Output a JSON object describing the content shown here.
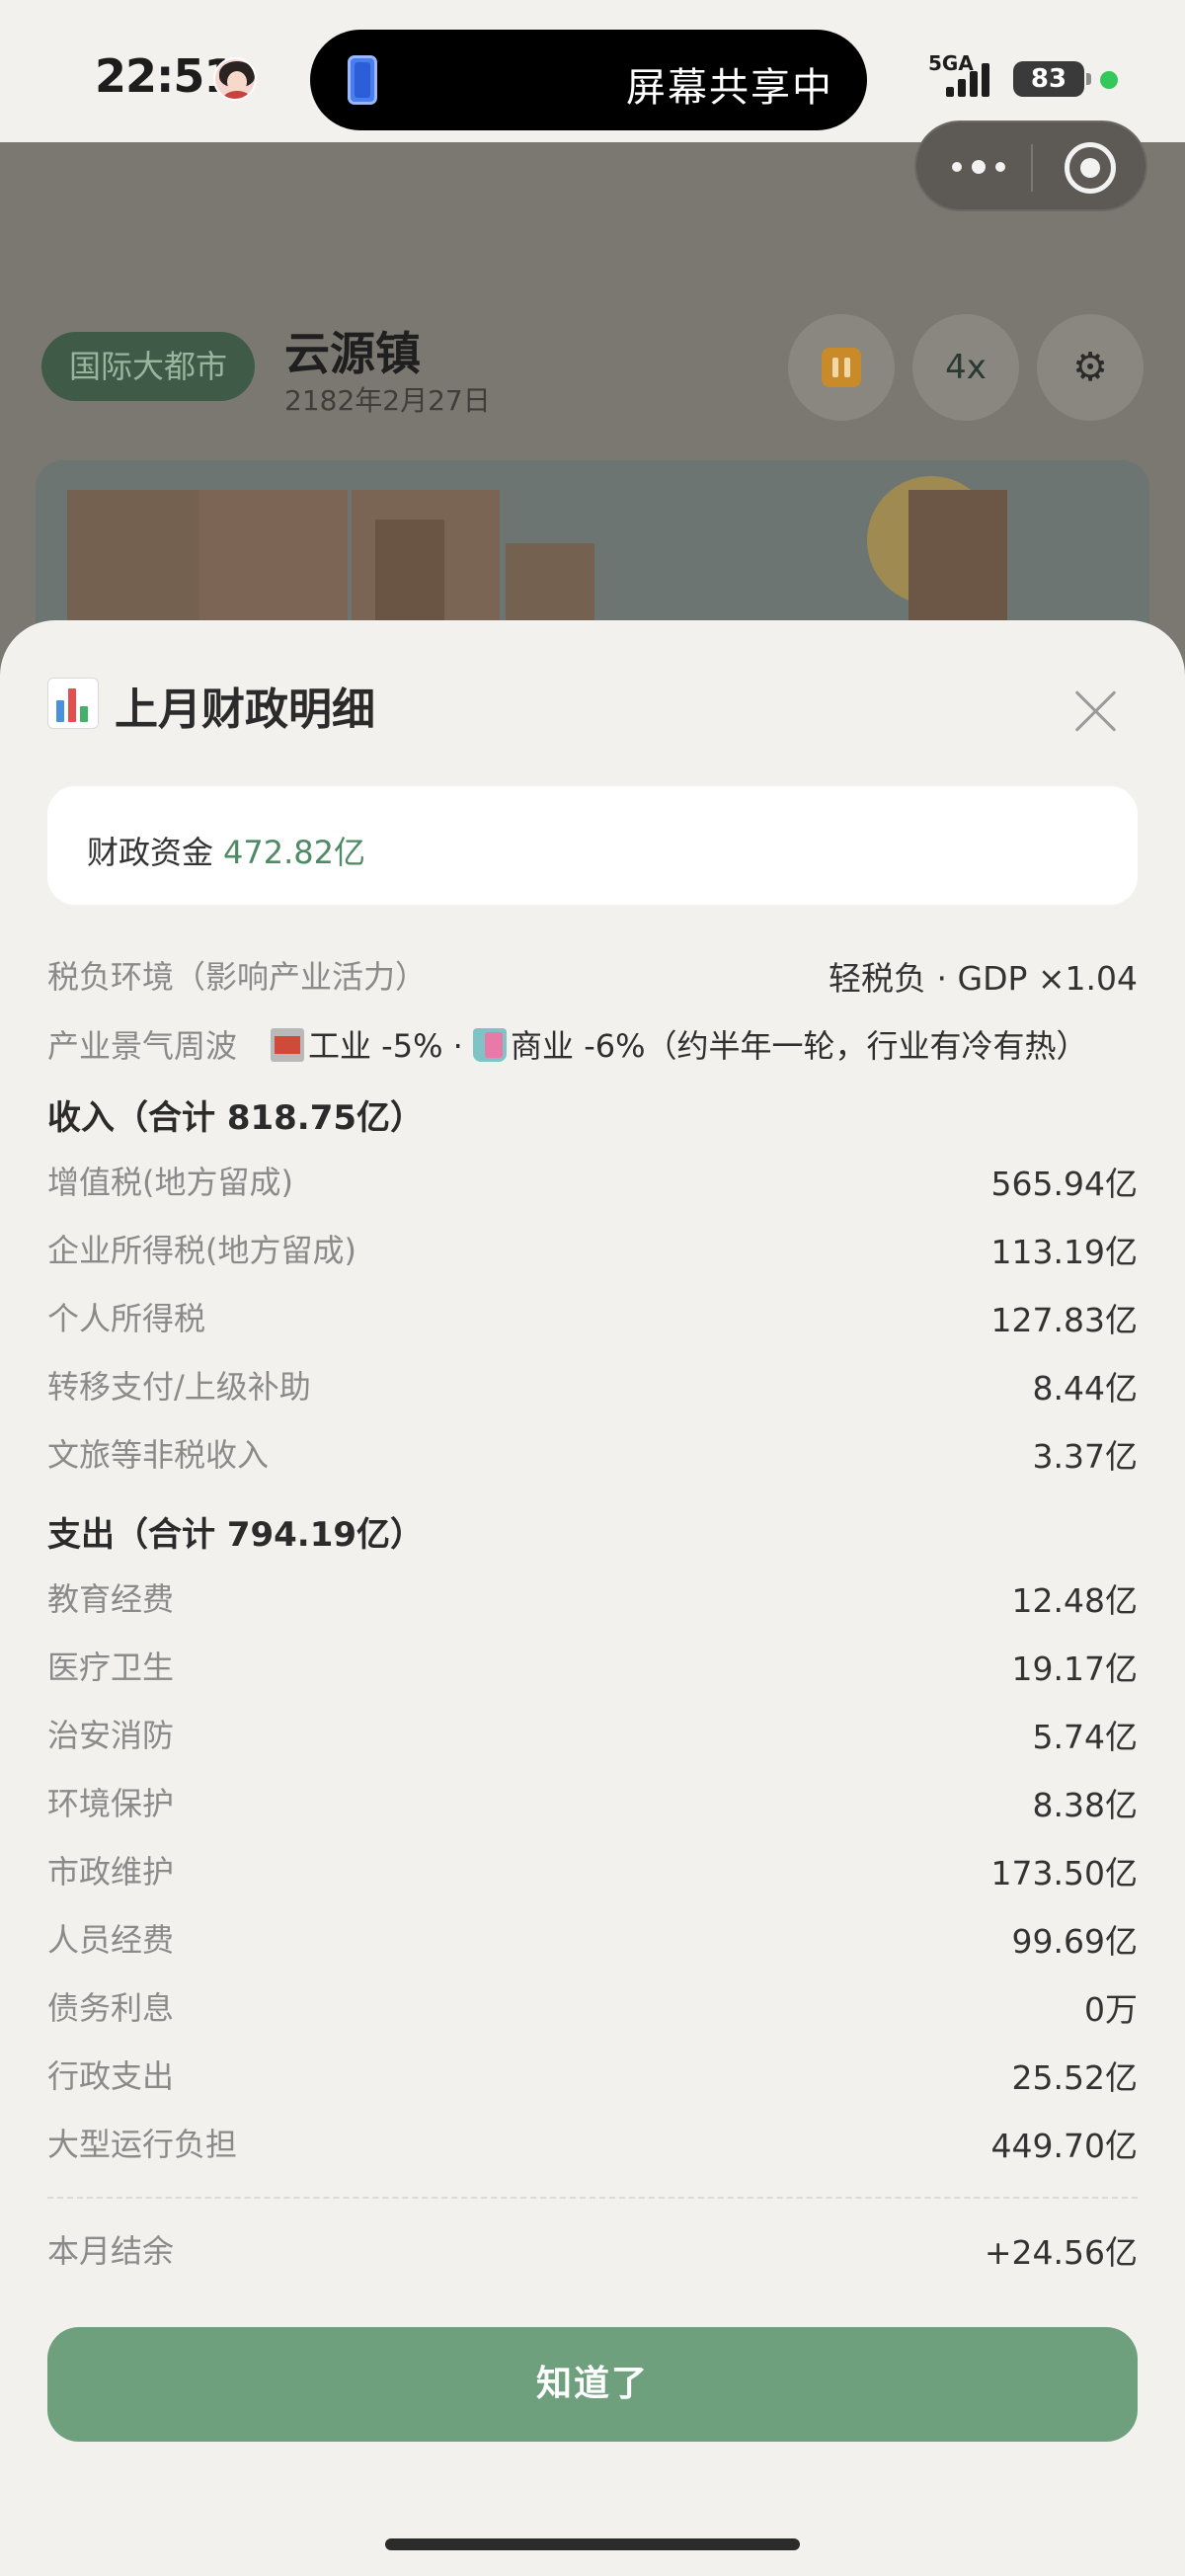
{
  "status_bar": {
    "time": "22:51",
    "screen_share_text": "屏幕共享中",
    "network": "5GA",
    "battery": "83"
  },
  "game": {
    "level_badge": "国际大都市",
    "city_name": "云源镇",
    "date": "2182年2月27日",
    "speed": "4x",
    "icons": [
      "pause-icon",
      "gear-icon",
      "more-icon",
      "target-icon"
    ]
  },
  "modal": {
    "title": "上月财政明细",
    "title_icon": "bar-chart-icon",
    "fund_label": "财政资金",
    "fund_value": "472.82亿",
    "tax_env": {
      "label": "税负环境（影响产业活力）",
      "value": "轻税负 · GDP ×1.04"
    },
    "cycle": {
      "label": "产业景气周波",
      "industry": "工业 -5% · ",
      "commerce": "商业 -6%（约半年一轮，行业有冷有热）"
    },
    "income": {
      "heading": "收入（合计 818.75亿）",
      "items": [
        {
          "label": "增值税(地方留成)",
          "value": "565.94亿"
        },
        {
          "label": "企业所得税(地方留成)",
          "value": "113.19亿"
        },
        {
          "label": "个人所得税",
          "value": "127.83亿"
        },
        {
          "label": "转移支付/上级补助",
          "value": "8.44亿"
        },
        {
          "label": "文旅等非税收入",
          "value": "3.37亿"
        }
      ]
    },
    "expense": {
      "heading": "支出（合计 794.19亿）",
      "items": [
        {
          "label": "教育经费",
          "value": "12.48亿"
        },
        {
          "label": "医疗卫生",
          "value": "19.17亿"
        },
        {
          "label": "治安消防",
          "value": "5.74亿"
        },
        {
          "label": "环境保护",
          "value": "8.38亿"
        },
        {
          "label": "市政维护",
          "value": "173.50亿"
        },
        {
          "label": "人员经费",
          "value": "99.69亿"
        },
        {
          "label": "债务利息",
          "value": "0万"
        },
        {
          "label": "行政支出",
          "value": "25.52亿"
        },
        {
          "label": "大型运行负担",
          "value": "449.70亿"
        }
      ]
    },
    "balance": {
      "label": "本月结余",
      "value": "+24.56亿"
    },
    "confirm_label": "知道了"
  },
  "colors": {
    "accent": "#6fa07e",
    "fund_value": "#4f8a66",
    "sheet_bg": "#f2f1ed"
  }
}
